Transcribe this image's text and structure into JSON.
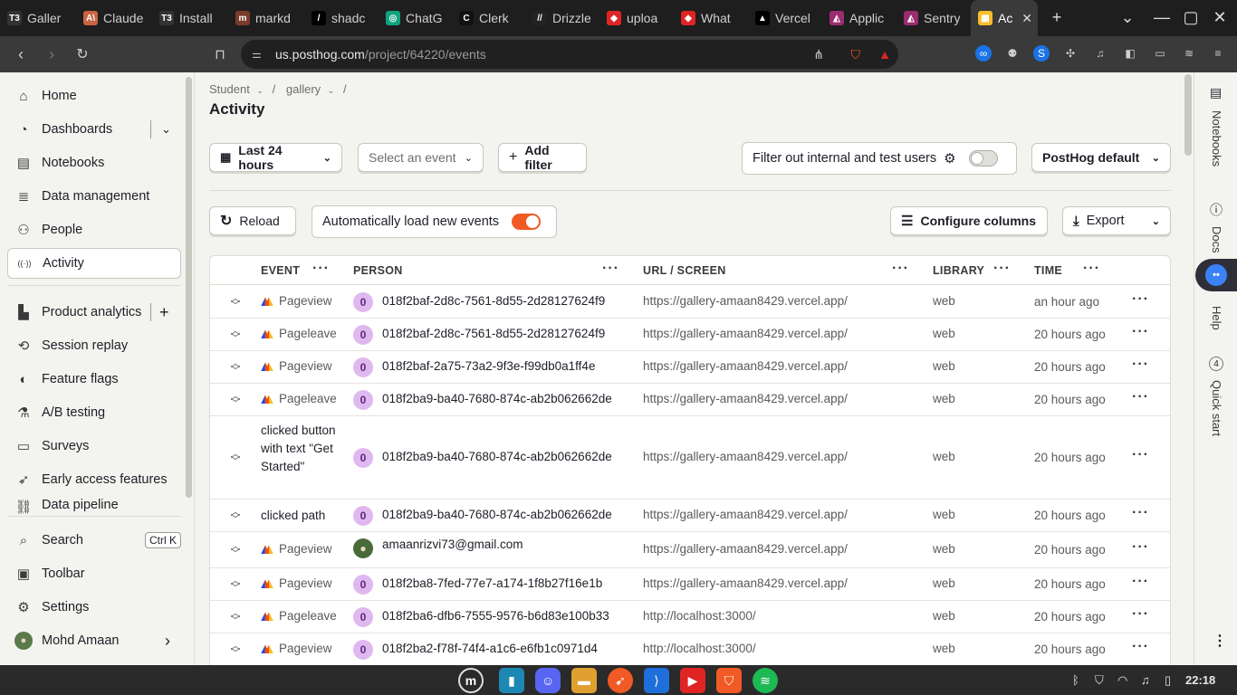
{
  "browser": {
    "tabs": [
      {
        "label": "Galler",
        "fav": "T3",
        "color": "#333"
      },
      {
        "label": "Claude",
        "fav": "A\\",
        "color": "#c96442"
      },
      {
        "label": "Install",
        "fav": "T3",
        "color": "#333"
      },
      {
        "label": "markd",
        "fav": "m",
        "color": "#7a3b2b"
      },
      {
        "label": "shadc",
        "fav": "/",
        "color": "#000"
      },
      {
        "label": "ChatG",
        "fav": "◎",
        "color": "#10a37f"
      },
      {
        "label": "Clerk",
        "fav": "C",
        "color": "#111"
      },
      {
        "label": "Drizzle",
        "fav": "//",
        "color": "#222"
      },
      {
        "label": "uploa",
        "fav": "◆",
        "color": "#e02424"
      },
      {
        "label": "What",
        "fav": "◆",
        "color": "#e02424"
      },
      {
        "label": "Vercel",
        "fav": "▲",
        "color": "#000"
      },
      {
        "label": "Applic",
        "fav": "◭",
        "color": "#9b2c6e"
      },
      {
        "label": "Sentry",
        "fav": "◭",
        "color": "#9b2c6e"
      },
      {
        "label": "Ac",
        "fav": "▦",
        "color": "#f9bd2b",
        "active": true
      }
    ],
    "url_host": "us.posthog.com",
    "url_path": "/project/64220/events"
  },
  "sidebar": {
    "items": [
      {
        "label": "Home",
        "icon": "home-icon",
        "glyph": "⌂"
      },
      {
        "label": "Dashboards",
        "icon": "dashboard-icon",
        "glyph": "◔"
      },
      {
        "label": "Notebooks",
        "icon": "notebook-icon",
        "glyph": "▤"
      },
      {
        "label": "Data management",
        "icon": "database-icon",
        "glyph": "≣"
      },
      {
        "label": "People",
        "icon": "people-icon",
        "glyph": "⚇"
      },
      {
        "label": "Activity",
        "icon": "activity-icon",
        "glyph": "((·))"
      },
      {
        "label": "Product analytics",
        "icon": "bar-chart-icon",
        "glyph": "▙"
      },
      {
        "label": "Session replay",
        "icon": "replay-icon",
        "glyph": "⟲"
      },
      {
        "label": "Feature flags",
        "icon": "toggle-icon",
        "glyph": "◐"
      },
      {
        "label": "A/B testing",
        "icon": "flask-icon",
        "glyph": "⚗"
      },
      {
        "label": "Surveys",
        "icon": "survey-icon",
        "glyph": "▭"
      },
      {
        "label": "Early access features",
        "icon": "rocket-icon",
        "glyph": "➶"
      },
      {
        "label": "Data pipeline",
        "icon": "pipeline-icon",
        "glyph": "⛓"
      },
      {
        "label": "Search",
        "icon": "search-icon",
        "glyph": "⌕",
        "shortcut": "Ctrl K"
      },
      {
        "label": "Toolbar",
        "icon": "toolbar-icon",
        "glyph": "▣"
      },
      {
        "label": "Settings",
        "icon": "gear-icon",
        "glyph": "⚙"
      },
      {
        "label": "Mohd Amaan",
        "icon": "avatar",
        "glyph": "●"
      }
    ]
  },
  "header": {
    "breadcrumb": [
      "Student",
      "gallery",
      "/"
    ],
    "title": "Activity"
  },
  "filters": {
    "date_range": "Last 24 hours",
    "event_select": "Select an event",
    "add_filter": "Add filter",
    "internal_filter": "Filter out internal and test users",
    "posthog_default": "PostHog default"
  },
  "toolbar": {
    "reload": "Reload",
    "auto_load": "Automatically load new events",
    "configure_columns": "Configure columns",
    "export": "Export"
  },
  "table": {
    "columns": [
      "EVENT",
      "PERSON",
      "URL / SCREEN",
      "LIBRARY",
      "TIME"
    ],
    "rows": [
      {
        "event": "Pageview",
        "person": "018f2baf-2d8c-7561-8d55-2d28127624f9",
        "url": "https://gallery-amaan8429.vercel.app/",
        "lib": "web",
        "time": "an hour ago",
        "h": 36
      },
      {
        "event": "Pageleave",
        "person": "018f2baf-2d8c-7561-8d55-2d28127624f9",
        "url": "https://gallery-amaan8429.vercel.app/",
        "lib": "web",
        "time": "20 hours ago",
        "h": 36
      },
      {
        "event": "Pageview",
        "person": "018f2baf-2a75-73a2-9f3e-f99db0a1ff4e",
        "url": "https://gallery-amaan8429.vercel.app/",
        "lib": "web",
        "time": "20 hours ago",
        "h": 36
      },
      {
        "event": "Pageleave",
        "person": "018f2ba9-ba40-7680-874c-ab2b062662de",
        "url": "https://gallery-amaan8429.vercel.app/",
        "lib": "web",
        "time": "20 hours ago",
        "h": 36
      },
      {
        "event": "clicked button with text \"Get Started\"",
        "person": "018f2ba9-ba40-7680-874c-ab2b062662de",
        "url": "https://gallery-amaan8429.vercel.app/",
        "lib": "web",
        "time": "20 hours ago",
        "h": 92,
        "plain": true
      },
      {
        "event": "clicked path",
        "person": "018f2ba9-ba40-7680-874c-ab2b062662de",
        "url": "https://gallery-amaan8429.vercel.app/",
        "lib": "web",
        "time": "20 hours ago",
        "h": 36,
        "plain": true
      },
      {
        "event": "Pageview",
        "person": "amaanrizvi73@gmail.com",
        "url": "https://gallery-amaan8429.vercel.app/",
        "lib": "web",
        "time": "20 hours ago",
        "h": 40,
        "photo": true
      },
      {
        "event": "Pageview",
        "person": "018f2ba8-7fed-77e7-a174-1f8b27f16e1b",
        "url": "https://gallery-amaan8429.vercel.app/",
        "lib": "web",
        "time": "20 hours ago",
        "h": 36
      },
      {
        "event": "Pageleave",
        "person": "018f2ba6-dfb6-7555-9576-b6d83e100b33",
        "url": "http://localhost:3000/",
        "lib": "web",
        "time": "20 hours ago",
        "h": 36
      },
      {
        "event": "Pageview",
        "person": "018f2ba2-f78f-74f4-a1c6-e6fb1c0971d4",
        "url": "http://localhost:3000/",
        "lib": "web",
        "time": "20 hours ago",
        "h": 36
      }
    ]
  },
  "right_panel": {
    "items": [
      "Notebooks",
      "Docs",
      "Help",
      "Quick start"
    ],
    "quick_start_count": "4"
  },
  "system": {
    "clock": "22:18"
  },
  "colors": {
    "accent_orange": "#f15a24",
    "avatar_purple": "#e0b8f0"
  }
}
